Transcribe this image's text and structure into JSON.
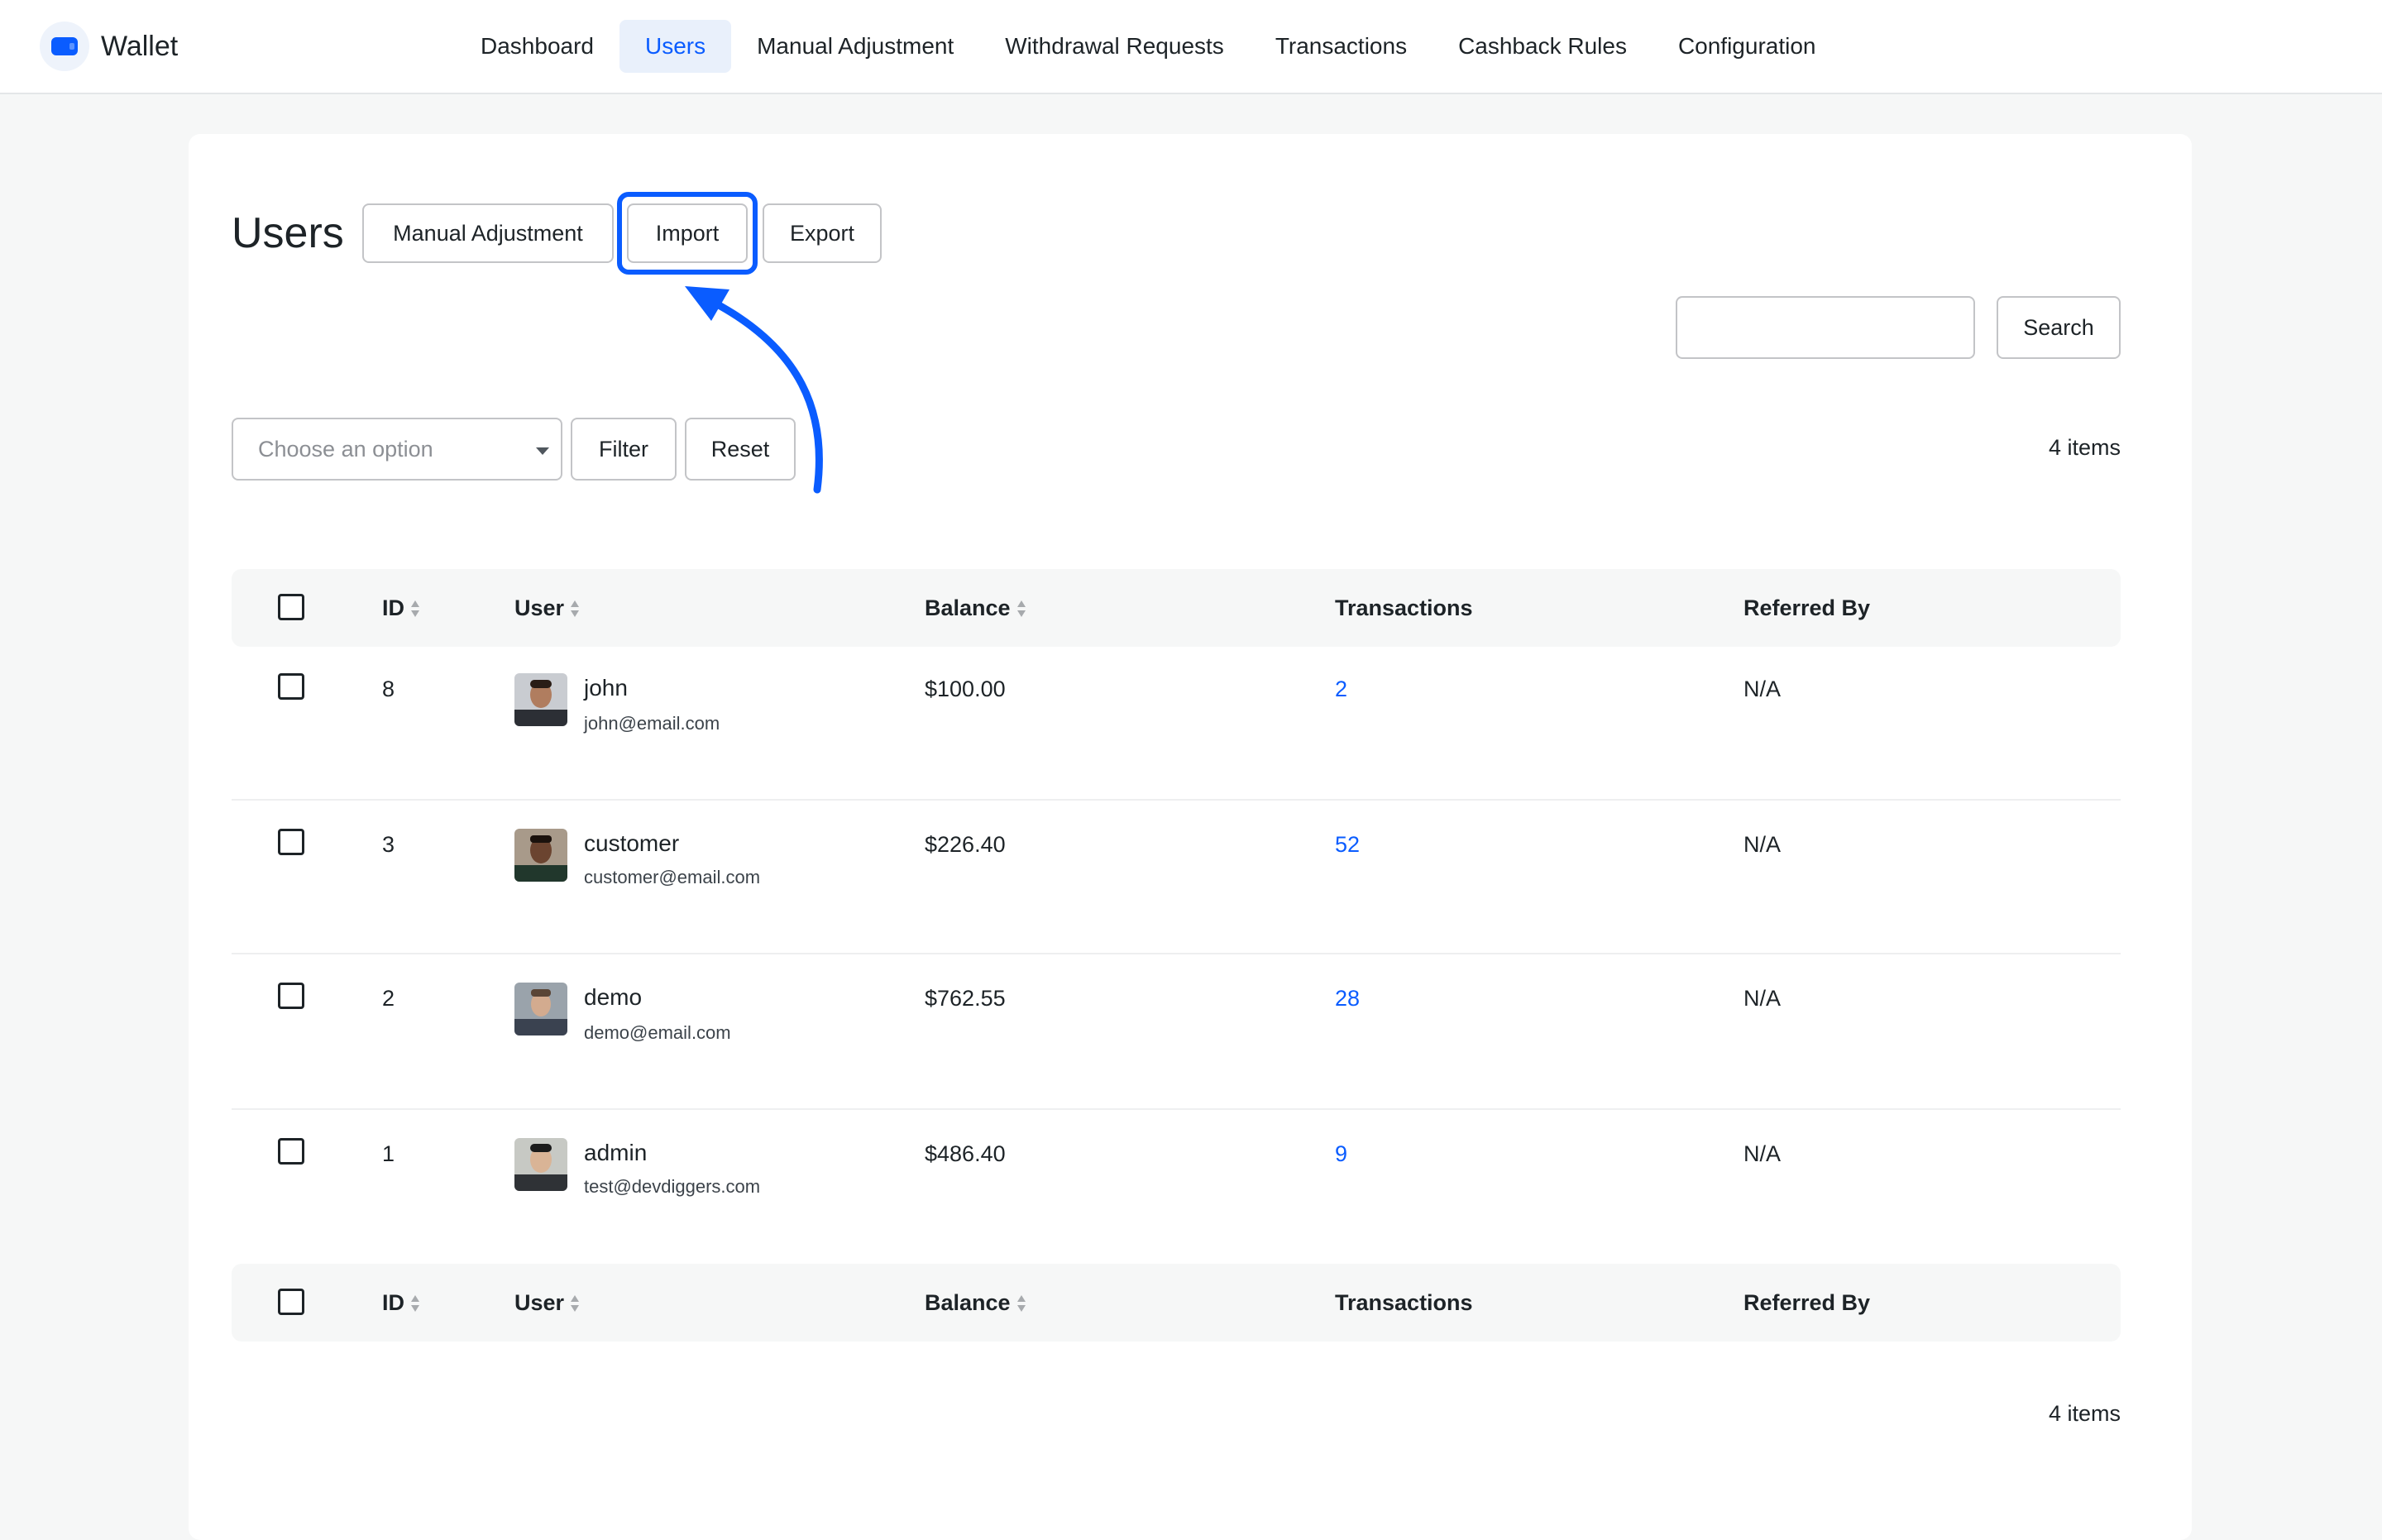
{
  "app": {
    "title": "Wallet"
  },
  "nav": {
    "items": [
      {
        "label": "Dashboard",
        "active": false
      },
      {
        "label": "Users",
        "active": true
      },
      {
        "label": "Manual Adjustment",
        "active": false
      },
      {
        "label": "Withdrawal Requests",
        "active": false
      },
      {
        "label": "Transactions",
        "active": false
      },
      {
        "label": "Cashback Rules",
        "active": false
      },
      {
        "label": "Configuration",
        "active": false
      }
    ]
  },
  "page": {
    "title": "Users",
    "actions": {
      "manual_adjustment": "Manual Adjustment",
      "import": "Import",
      "export": "Export"
    }
  },
  "search": {
    "value": "",
    "button": "Search"
  },
  "filter": {
    "select_placeholder": "Choose an option",
    "filter_button": "Filter",
    "reset_button": "Reset"
  },
  "counts": {
    "top": "4 items",
    "bottom": "4 items"
  },
  "table": {
    "columns": {
      "id": "ID",
      "user": "User",
      "balance": "Balance",
      "transactions": "Transactions",
      "referred_by": "Referred By"
    },
    "rows": [
      {
        "id": "8",
        "name": "john",
        "email": "john@email.com",
        "balance": "$100.00",
        "transactions": "2",
        "referred_by": "N/A"
      },
      {
        "id": "3",
        "name": "customer",
        "email": "customer@email.com",
        "balance": "$226.40",
        "transactions": "52",
        "referred_by": "N/A"
      },
      {
        "id": "2",
        "name": "demo",
        "email": "demo@email.com",
        "balance": "$762.55",
        "transactions": "28",
        "referred_by": "N/A"
      },
      {
        "id": "1",
        "name": "admin",
        "email": "test@devdiggers.com",
        "balance": "$486.40",
        "transactions": "9",
        "referred_by": "N/A"
      }
    ]
  },
  "colors": {
    "accent": "#0a5cff",
    "border": "#c3c4c7",
    "header_bg": "#f6f7f7"
  }
}
